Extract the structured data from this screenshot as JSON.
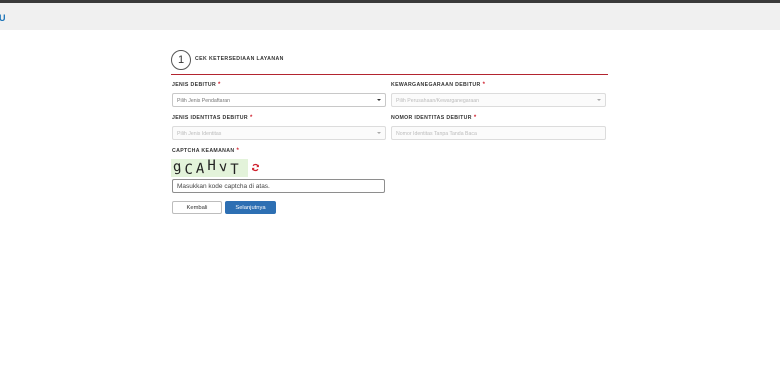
{
  "header": {
    "logo_text": "U"
  },
  "step": {
    "number": "1",
    "title": "CEK KETERSEDIAAN LAYANAN"
  },
  "form": {
    "jenis_debitur": {
      "label": "JENIS DEBITUR",
      "required_mark": "*",
      "placeholder": "Pilih Jenis Pendaftaran"
    },
    "kewarganegaraan": {
      "label": "KEWARGANEGARAAN DEBITUR",
      "required_mark": "*",
      "placeholder": "Pilih Perusahaan/Kewarganegaraan"
    },
    "jenis_identitas": {
      "label": "JENIS IDENTITAS DEBITUR",
      "required_mark": "*",
      "placeholder": "Pilih Jenis Identitas"
    },
    "nomor_identitas": {
      "label": "NOMOR IDENTITAS DEBITUR",
      "required_mark": "*",
      "placeholder": "Nomor Identitas Tanpa Tanda Baca"
    },
    "captcha": {
      "label": "CAPTCHA KEAMANAN",
      "required_mark": "*",
      "image_text": [
        "g",
        "C",
        "A",
        "H",
        "v",
        "T"
      ],
      "input_value": "Masukkan kode captcha di atas."
    }
  },
  "buttons": {
    "back_label": "Kembali",
    "next_label": "Selanjutnya"
  },
  "colors": {
    "accent_line": "#b3242f",
    "primary_button": "#2d6fb3",
    "captcha_bg": "#e3f3da",
    "required": "#d0212e"
  },
  "icons": {
    "refresh": "refresh-icon",
    "dropdown": "caret-down-icon"
  }
}
